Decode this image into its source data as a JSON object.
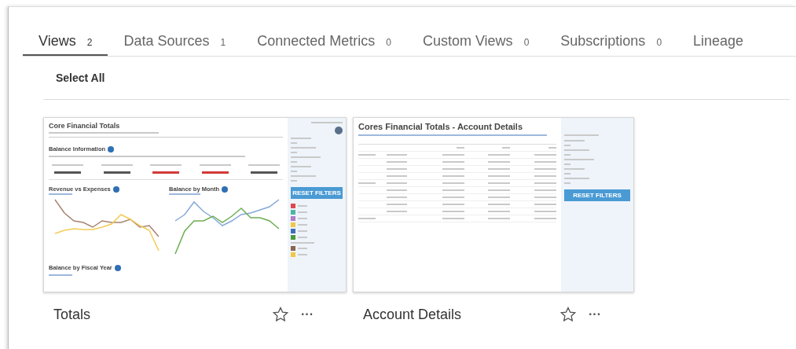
{
  "tabs": [
    {
      "label": "Views",
      "count": "2",
      "selected": true
    },
    {
      "label": "Data Sources",
      "count": "1",
      "selected": false
    },
    {
      "label": "Connected Metrics",
      "count": "0",
      "selected": false
    },
    {
      "label": "Custom Views",
      "count": "0",
      "selected": false
    },
    {
      "label": "Subscriptions",
      "count": "0",
      "selected": false
    },
    {
      "label": "Lineage",
      "selected": false
    }
  ],
  "select_all": "Select All",
  "views": [
    {
      "name": "Totals",
      "starred": false,
      "more": "···",
      "thumbnail": {
        "kind": "dashboard",
        "title": "Core Financial Totals",
        "sections": [
          "Balance Information",
          "Revenue vs Expenses",
          "Balance by Month",
          "Balance by Fiscal Year"
        ],
        "button": "RESET FILTERS",
        "legend": [
          {
            "color": "#e0474c"
          },
          {
            "color": "#4fb3a4"
          },
          {
            "color": "#b07cc6"
          },
          {
            "color": "#f2c744"
          },
          {
            "color": "#3f6fb5"
          },
          {
            "color": "#4a9a3c"
          },
          {
            "color": "#8c6450"
          },
          {
            "color": "#f2c744"
          }
        ]
      }
    },
    {
      "name": "Account Details",
      "starred": false,
      "more": "···",
      "thumbnail": {
        "kind": "table",
        "title": "Cores Financial Totals - Account Details",
        "button": "RESET FILTERS"
      }
    }
  ]
}
